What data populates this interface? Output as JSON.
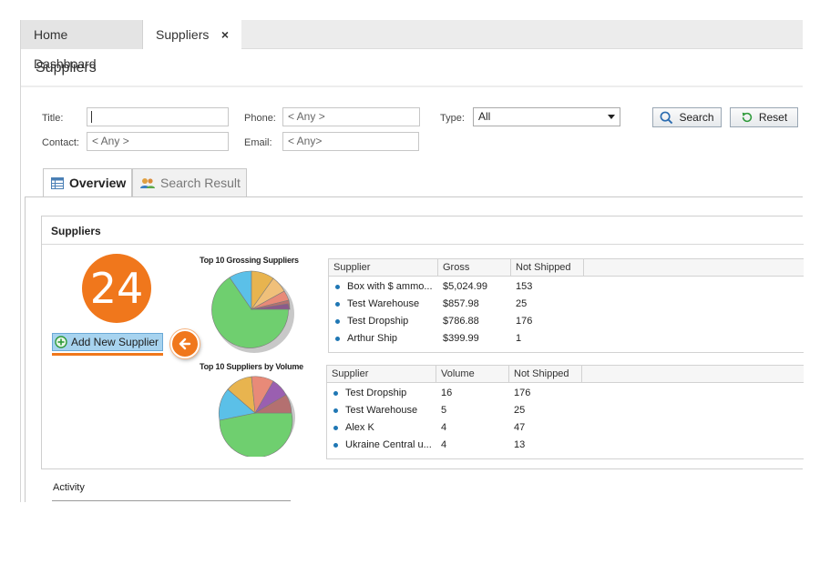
{
  "tabs": [
    {
      "label": "Home Dashboard"
    },
    {
      "label": "Suppliers",
      "close": "×"
    }
  ],
  "page_title": "Suppliers",
  "filters": {
    "title_label": "Title:",
    "title_value": "",
    "contact_label": "Contact:",
    "contact_placeholder": "< Any >",
    "phone_label": "Phone:",
    "phone_placeholder": "< Any >",
    "email_label": "Email:",
    "email_placeholder": "< Any>",
    "type_label": "Type:",
    "type_value": "All",
    "search_label": "Search",
    "reset_label": "Reset"
  },
  "section_tabs": [
    {
      "label": "Overview",
      "icon": "table-icon"
    },
    {
      "label": "Search Result",
      "icon": "people-icon"
    }
  ],
  "panel": {
    "title": "Suppliers",
    "count": "24",
    "add_label": "Add New Supplier"
  },
  "charts": {
    "gross_title": "Top 10 Grossing Suppliers",
    "volume_title": "Top 10 Suppliers by Volume"
  },
  "gross_table": {
    "headers": [
      "Supplier",
      "Gross",
      "Not Shipped"
    ],
    "rows": [
      [
        "Box with $ ammo...",
        "$5,024.99",
        "153"
      ],
      [
        "Test Warehouse",
        "$857.98",
        "25"
      ],
      [
        "Test Dropship",
        "$786.88",
        "176"
      ],
      [
        "Arthur Ship",
        "$399.99",
        "1"
      ]
    ]
  },
  "volume_table": {
    "headers": [
      "Supplier",
      "Volume",
      "Not Shipped"
    ],
    "rows": [
      [
        "Test Dropship",
        "16",
        "176"
      ],
      [
        "Test Warehouse",
        "5",
        "25"
      ],
      [
        "Alex K",
        "4",
        "47"
      ],
      [
        "Ukraine Central u...",
        "4",
        "13"
      ]
    ]
  },
  "activity_label": "Activity",
  "colors": {
    "accent": "#f0771c",
    "bullet": "#1f77b4",
    "add_button": "#a7d3ef"
  }
}
